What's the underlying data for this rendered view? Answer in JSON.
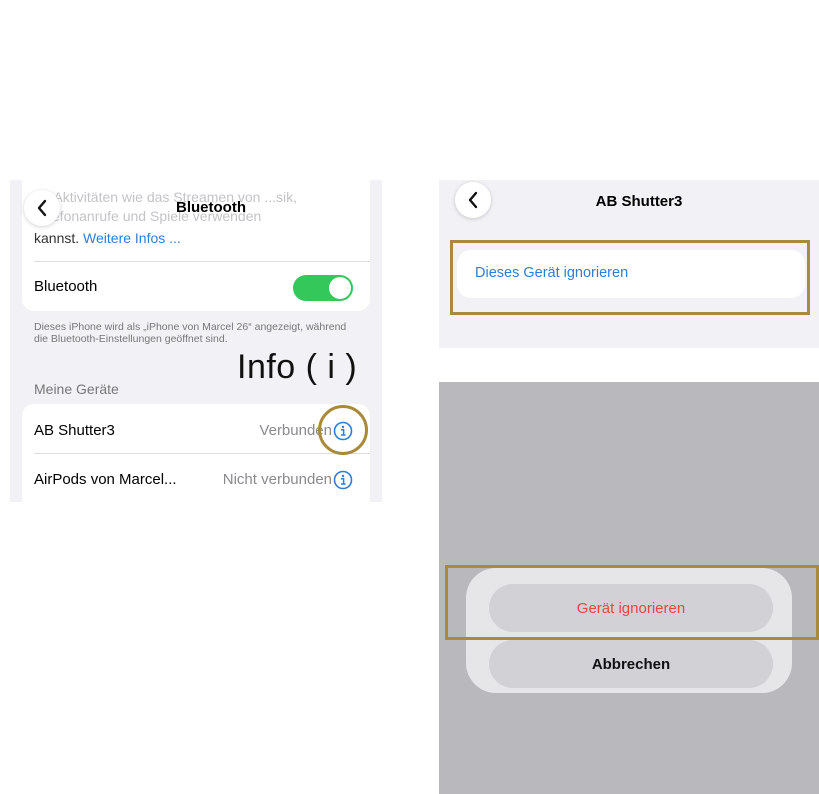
{
  "bluetooth_screen": {
    "title": "Bluetooth",
    "intro_faded": "...r Aktivitäten wie das Streamen von ...sik, Telefonanrufe und Spiele verwenden",
    "intro_text": "kannst.",
    "intro_link": "Weitere Infos ...",
    "bluetooth_label": "Bluetooth",
    "bluetooth_on": true,
    "description": "Dieses iPhone wird als „iPhone von Marcel 26“ angezeigt, während die Bluetooth-Einstellungen geöffnet sind.",
    "annotation": "Info ( i )",
    "section_header": "Meine Geräte",
    "devices": [
      {
        "name": "AB Shutter3",
        "status": "Verbunden"
      },
      {
        "name": "AirPods von Marcel...",
        "status": "Nicht verbunden"
      }
    ]
  },
  "device_screen": {
    "title": "AB Shutter3",
    "action": "Dieses Gerät ignorieren"
  },
  "action_sheet": {
    "ignore_label": "Gerät ignorieren",
    "cancel_label": "Abbrechen"
  },
  "colors": {
    "accent_blue": "#2e7ed8",
    "toggle_green": "#34c759",
    "destructive_red": "#e94545",
    "highlight_gold": "#a88a3a"
  }
}
